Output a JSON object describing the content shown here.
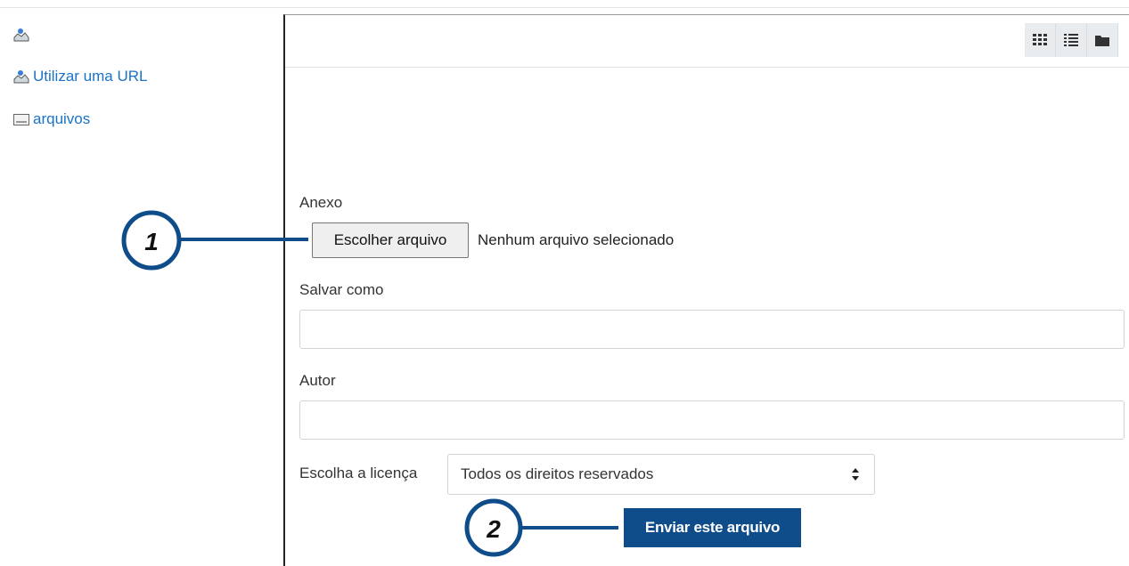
{
  "sidebar": {
    "items": [
      {
        "label": "",
        "icon": "upload-icon"
      },
      {
        "label": "Utilizar uma URL",
        "icon": "upload-icon"
      },
      {
        "label": "arquivos",
        "icon": "drive-icon"
      }
    ]
  },
  "toolbar": {
    "view_buttons": [
      "grid-view-icon",
      "list-view-icon",
      "folder-view-icon"
    ]
  },
  "form": {
    "attachment_label": "Anexo",
    "choose_file_button": "Escolher arquivo",
    "file_status": "Nenhum arquivo selecionado",
    "save_as_label": "Salvar como",
    "save_as_value": "",
    "author_label": "Autor",
    "author_value": "",
    "license_label": "Escolha a licença",
    "license_selected": "Todos os direitos reservados",
    "submit_button": "Enviar este arquivo"
  },
  "callouts": {
    "one": "1",
    "two": "2",
    "color": "#0f4d8a"
  }
}
